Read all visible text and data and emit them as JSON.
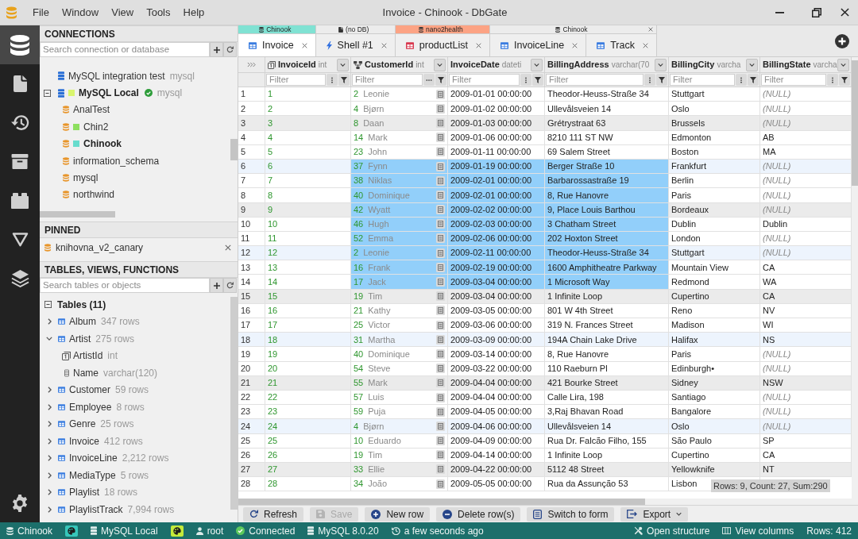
{
  "window": {
    "title": "Invoice - Chinook - DbGate"
  },
  "menu": [
    "File",
    "Window",
    "View",
    "Tools",
    "Help"
  ],
  "activity_bar": [
    {
      "kind": "database",
      "selected": true
    },
    {
      "kind": "file",
      "selected": false
    },
    {
      "kind": "history",
      "selected": false
    },
    {
      "kind": "archive",
      "selected": false
    },
    {
      "kind": "plugin",
      "selected": false
    },
    {
      "kind": "triangle",
      "selected": false
    },
    {
      "kind": "layers",
      "selected": false
    },
    {
      "kind": "settings",
      "selected": false
    }
  ],
  "connections": {
    "title": "CONNECTIONS",
    "search_placeholder": "Search connection or database",
    "items": [
      {
        "label": "MySQL integration test",
        "note": "mysql",
        "kind": "server",
        "current": false
      },
      {
        "label": "MySQL Local",
        "note": "mysql",
        "kind": "server",
        "color": "#d9f56e",
        "expanded": true,
        "connected": true,
        "current": true,
        "children": [
          {
            "label": "AnalTest",
            "kind": "database",
            "current": false
          },
          {
            "label": "Chin2",
            "kind": "database",
            "color": "#8ddf5f",
            "current": false
          },
          {
            "label": "Chinook",
            "kind": "database",
            "color": "#67dccd",
            "current": true
          },
          {
            "label": "information_schema",
            "kind": "database",
            "current": false
          },
          {
            "label": "mysql",
            "kind": "database",
            "current": false
          },
          {
            "label": "northwind",
            "kind": "database",
            "current": false
          }
        ]
      }
    ]
  },
  "pinned": {
    "title": "PINNED",
    "items": [
      {
        "label": "knihovna_v2_canary"
      }
    ]
  },
  "objects": {
    "title": "TABLES, VIEWS, FUNCTIONS",
    "search_placeholder": "Search tables or objects",
    "groups": [
      {
        "label": "Tables (11)",
        "expanded": true,
        "items": [
          {
            "name": "Album",
            "rows": "347 rows",
            "expanded": false
          },
          {
            "name": "Artist",
            "rows": "275 rows",
            "expanded": true,
            "columns": [
              {
                "name": "ArtistId",
                "type": "int",
                "kind": "primary_key"
              },
              {
                "name": "Name",
                "type": "varchar(120)",
                "kind": "column"
              }
            ]
          },
          {
            "name": "Customer",
            "rows": "59 rows",
            "expanded": false
          },
          {
            "name": "Employee",
            "rows": "8 rows",
            "expanded": false
          },
          {
            "name": "Genre",
            "rows": "25 rows",
            "expanded": false
          },
          {
            "name": "Invoice",
            "rows": "412 rows",
            "expanded": false
          },
          {
            "name": "InvoiceLine",
            "rows": "2,212 rows",
            "expanded": false
          },
          {
            "name": "MediaType",
            "rows": "5 rows",
            "expanded": false
          },
          {
            "name": "Playlist",
            "rows": "18 rows",
            "expanded": false
          },
          {
            "name": "PlaylistTrack",
            "rows": "7,994 rows",
            "expanded": false
          }
        ]
      }
    ]
  },
  "tabs": {
    "groups": [
      {
        "label": "Chinook",
        "kind": "database",
        "color": "#80e2d3",
        "tabs": [
          {
            "label": "Invoice",
            "kind": "table",
            "selected": true
          }
        ]
      },
      {
        "label": "(no DB)",
        "kind": "file",
        "tabs": [
          {
            "label": "Shell #1",
            "kind": "shell",
            "selected": false
          }
        ]
      },
      {
        "label": "nano2health",
        "kind": "database",
        "color": "#fca384",
        "tabs": [
          {
            "label": "productList",
            "kind": "view",
            "selected": false
          }
        ]
      },
      {
        "label": "Chinook",
        "kind": "database",
        "closable": true,
        "tabs": [
          {
            "label": "InvoiceLine",
            "kind": "table",
            "selected": false
          },
          {
            "label": "Track",
            "kind": "table",
            "selected": false
          }
        ]
      }
    ]
  },
  "grid": {
    "columns": [
      {
        "name": "InvoiceId",
        "type": "int",
        "kind": "primary_key",
        "filter_placeholder": "Filter",
        "selected": false
      },
      {
        "name": "CustomerId",
        "type": "int",
        "kind": "foreign_key",
        "filter_placeholder": "Filter",
        "selected": true
      },
      {
        "name": "InvoiceDate",
        "type": "dateti",
        "kind": "plain",
        "filter_placeholder": "Filter",
        "selected": true
      },
      {
        "name": "BillingAddress",
        "type": "varchar(70",
        "kind": "plain",
        "filter_placeholder": "Filter",
        "selected": true
      },
      {
        "name": "BillingCity",
        "type": "varcha",
        "kind": "plain",
        "filter_placeholder": "Filter",
        "selected": false
      },
      {
        "name": "BillingState",
        "type": "varcha",
        "kind": "plain",
        "filter_placeholder": "Filter",
        "selected": false
      }
    ],
    "rows": [
      {
        "number": "1",
        "invoice_id": "1",
        "customer_id": "2",
        "customer_name": "Leonie",
        "invoice_date": "2009-01-01 00:00:00",
        "billing_address": "Theodor-Heuss-Straße 34",
        "billing_city": "Stuttgart",
        "billing_state": "(NULL)",
        "billing_state_null": true,
        "selected": false
      },
      {
        "number": "2",
        "invoice_id": "2",
        "customer_id": "4",
        "customer_name": "Bjørn",
        "invoice_date": "2009-01-02 00:00:00",
        "billing_address": "Ullevålsveien 14",
        "billing_city": "Oslo",
        "billing_state": "(NULL)",
        "billing_state_null": true,
        "selected": false
      },
      {
        "number": "3",
        "invoice_id": "3",
        "customer_id": "8",
        "customer_name": "Daan",
        "invoice_date": "2009-01-03 00:00:00",
        "billing_address": "Grétrystraat 63",
        "billing_city": "Brussels",
        "billing_state": "(NULL)",
        "billing_state_null": true,
        "selected": false
      },
      {
        "number": "4",
        "invoice_id": "4",
        "customer_id": "14",
        "customer_name": "Mark",
        "invoice_date": "2009-01-06 00:00:00",
        "billing_address": "8210 111 ST NW",
        "billing_city": "Edmonton",
        "billing_state": "AB",
        "billing_state_null": false,
        "selected": false
      },
      {
        "number": "5",
        "invoice_id": "5",
        "customer_id": "23",
        "customer_name": "John",
        "invoice_date": "2009-01-11 00:00:00",
        "billing_address": "69 Salem Street",
        "billing_city": "Boston",
        "billing_state": "MA",
        "billing_state_null": false,
        "selected": false
      },
      {
        "number": "6",
        "invoice_id": "6",
        "customer_id": "37",
        "customer_name": "Fynn",
        "invoice_date": "2009-01-19 00:00:00",
        "billing_address": "Berger Straße 10",
        "billing_city": "Frankfurt",
        "billing_state": "(NULL)",
        "billing_state_null": true,
        "selected": true
      },
      {
        "number": "7",
        "invoice_id": "7",
        "customer_id": "38",
        "customer_name": "Niklas",
        "invoice_date": "2009-02-01 00:00:00",
        "billing_address": "Barbarossastraße 19",
        "billing_city": "Berlin",
        "billing_state": "(NULL)",
        "billing_state_null": true,
        "selected": true
      },
      {
        "number": "8",
        "invoice_id": "8",
        "customer_id": "40",
        "customer_name": "Dominique",
        "invoice_date": "2009-02-01 00:00:00",
        "billing_address": "8, Rue Hanovre",
        "billing_city": "Paris",
        "billing_state": "(NULL)",
        "billing_state_null": true,
        "selected": true
      },
      {
        "number": "9",
        "invoice_id": "9",
        "customer_id": "42",
        "customer_name": "Wyatt",
        "invoice_date": "2009-02-02 00:00:00",
        "billing_address": "9, Place Louis Barthou",
        "billing_city": "Bordeaux",
        "billing_state": "(NULL)",
        "billing_state_null": true,
        "selected": true
      },
      {
        "number": "10",
        "invoice_id": "10",
        "customer_id": "46",
        "customer_name": "Hugh",
        "invoice_date": "2009-02-03 00:00:00",
        "billing_address": "3 Chatham Street",
        "billing_city": "Dublin",
        "billing_state": "Dublin",
        "billing_state_null": false,
        "selected": true
      },
      {
        "number": "11",
        "invoice_id": "11",
        "customer_id": "52",
        "customer_name": "Emma",
        "invoice_date": "2009-02-06 00:00:00",
        "billing_address": "202 Hoxton Street",
        "billing_city": "London",
        "billing_state": "(NULL)",
        "billing_state_null": true,
        "selected": true
      },
      {
        "number": "12",
        "invoice_id": "12",
        "customer_id": "2",
        "customer_name": "Leonie",
        "invoice_date": "2009-02-11 00:00:00",
        "billing_address": "Theodor-Heuss-Straße 34",
        "billing_city": "Stuttgart",
        "billing_state": "(NULL)",
        "billing_state_null": true,
        "selected": true
      },
      {
        "number": "13",
        "invoice_id": "13",
        "customer_id": "16",
        "customer_name": "Frank",
        "invoice_date": "2009-02-19 00:00:00",
        "billing_address": "1600 Amphitheatre Parkway",
        "billing_city": "Mountain View",
        "billing_state": "CA",
        "billing_state_null": false,
        "selected": true
      },
      {
        "number": "14",
        "invoice_id": "14",
        "customer_id": "17",
        "customer_name": "Jack",
        "invoice_date": "2009-03-04 00:00:00",
        "billing_address": "1 Microsoft Way",
        "billing_city": "Redmond",
        "billing_state": "WA",
        "billing_state_null": false,
        "selected": true
      },
      {
        "number": "15",
        "invoice_id": "15",
        "customer_id": "19",
        "customer_name": "Tim",
        "invoice_date": "2009-03-04 00:00:00",
        "billing_address": "1 Infinite Loop",
        "billing_city": "Cupertino",
        "billing_state": "CA",
        "billing_state_null": false,
        "selected": false
      },
      {
        "number": "16",
        "invoice_id": "16",
        "customer_id": "21",
        "customer_name": "Kathy",
        "invoice_date": "2009-03-05 00:00:00",
        "billing_address": "801 W 4th Street",
        "billing_city": "Reno",
        "billing_state": "NV",
        "billing_state_null": false,
        "selected": false
      },
      {
        "number": "17",
        "invoice_id": "17",
        "customer_id": "25",
        "customer_name": "Victor",
        "invoice_date": "2009-03-06 00:00:00",
        "billing_address": "319 N. Frances Street",
        "billing_city": "Madison",
        "billing_state": "WI",
        "billing_state_null": false,
        "selected": false
      },
      {
        "number": "18",
        "invoice_id": "18",
        "customer_id": "31",
        "customer_name": "Martha",
        "invoice_date": "2009-03-09 00:00:00",
        "billing_address": "194A Chain Lake Drive",
        "billing_city": "Halifax",
        "billing_state": "NS",
        "billing_state_null": false,
        "selected": false
      },
      {
        "number": "19",
        "invoice_id": "19",
        "customer_id": "40",
        "customer_name": "Dominique",
        "invoice_date": "2009-03-14 00:00:00",
        "billing_address": "8, Rue Hanovre",
        "billing_city": "Paris",
        "billing_state": "(NULL)",
        "billing_state_null": true,
        "selected": false
      },
      {
        "number": "20",
        "invoice_id": "20",
        "customer_id": "54",
        "customer_name": "Steve",
        "invoice_date": "2009-03-22 00:00:00",
        "billing_address": "110 Raeburn Pl",
        "billing_city": "Edinburgh•",
        "billing_state": "(NULL)",
        "billing_state_null": true,
        "selected": false
      },
      {
        "number": "21",
        "invoice_id": "21",
        "customer_id": "55",
        "customer_name": "Mark",
        "invoice_date": "2009-04-04 00:00:00",
        "billing_address": "421 Bourke Street",
        "billing_city": "Sidney",
        "billing_state": "NSW",
        "billing_state_null": false,
        "selected": false
      },
      {
        "number": "22",
        "invoice_id": "22",
        "customer_id": "57",
        "customer_name": "Luis",
        "invoice_date": "2009-04-04 00:00:00",
        "billing_address": "Calle Lira, 198",
        "billing_city": "Santiago",
        "billing_state": "(NULL)",
        "billing_state_null": true,
        "selected": false
      },
      {
        "number": "23",
        "invoice_id": "23",
        "customer_id": "59",
        "customer_name": "Puja",
        "invoice_date": "2009-04-05 00:00:00",
        "billing_address": "3,Raj Bhavan Road",
        "billing_city": "Bangalore",
        "billing_state": "(NULL)",
        "billing_state_null": true,
        "selected": false
      },
      {
        "number": "24",
        "invoice_id": "24",
        "customer_id": "4",
        "customer_name": "Bjørn",
        "invoice_date": "2009-04-06 00:00:00",
        "billing_address": "Ullevålsveien 14",
        "billing_city": "Oslo",
        "billing_state": "(NULL)",
        "billing_state_null": true,
        "selected": false
      },
      {
        "number": "25",
        "invoice_id": "25",
        "customer_id": "10",
        "customer_name": "Eduardo",
        "invoice_date": "2009-04-09 00:00:00",
        "billing_address": "Rua Dr. Falcão Filho, 155",
        "billing_city": "São Paulo",
        "billing_state": "SP",
        "billing_state_null": false,
        "selected": false
      },
      {
        "number": "26",
        "invoice_id": "26",
        "customer_id": "19",
        "customer_name": "Tim",
        "invoice_date": "2009-04-14 00:00:00",
        "billing_address": "1 Infinite Loop",
        "billing_city": "Cupertino",
        "billing_state": "CA",
        "billing_state_null": false,
        "selected": false
      },
      {
        "number": "27",
        "invoice_id": "27",
        "customer_id": "33",
        "customer_name": "Ellie",
        "invoice_date": "2009-04-22 00:00:00",
        "billing_address": "5112 48 Street",
        "billing_city": "Yellowknife",
        "billing_state": "NT",
        "billing_state_null": false,
        "selected": false
      },
      {
        "number": "28",
        "invoice_id": "28",
        "customer_id": "34",
        "customer_name": "João",
        "invoice_date": "2009-05-05 00:00:00",
        "billing_address": "Rua da Assunção 53",
        "billing_city": "Lisbon",
        "selected": false
      }
    ],
    "selection_summary": "Rows: 9, Count: 27, Sum:290"
  },
  "toolbar": [
    {
      "label": "Refresh",
      "kind": "refresh",
      "disabled": false,
      "dropdown": false
    },
    {
      "label": "Save",
      "kind": "save",
      "disabled": true,
      "dropdown": false
    },
    {
      "label": "New row",
      "kind": "add",
      "disabled": false,
      "dropdown": false
    },
    {
      "label": "Delete row(s)",
      "kind": "delete",
      "disabled": false,
      "dropdown": false
    },
    {
      "label": "Switch to form",
      "kind": "form",
      "disabled": false,
      "dropdown": false
    },
    {
      "label": "Export",
      "kind": "export",
      "disabled": false,
      "dropdown": true
    }
  ],
  "status_bar": {
    "left": [
      {
        "kind": "database",
        "text": "Chinook"
      },
      {
        "kind": "palette",
        "color": "#37c6ba"
      },
      {
        "kind": "server",
        "text": "MySQL Local"
      },
      {
        "kind": "palette",
        "color": "#c3ea3b"
      },
      {
        "kind": "user",
        "text": "root"
      },
      {
        "kind": "connected",
        "text": "Connected"
      },
      {
        "kind": "server",
        "text": "MySQL 8.0.20"
      },
      {
        "kind": "history",
        "text": "a few seconds ago"
      }
    ],
    "right": [
      {
        "kind": "structure",
        "text": "Open structure"
      },
      {
        "kind": "columns",
        "text": "View columns"
      },
      {
        "kind": "text",
        "text": "Rows: 412"
      }
    ]
  }
}
